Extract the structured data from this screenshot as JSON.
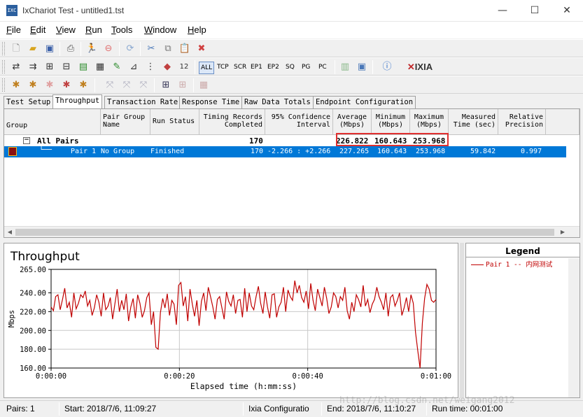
{
  "window": {
    "title": "IxChariot Test - untitled1.tst",
    "app_icon_text": "IXC",
    "minimize": "—",
    "maximize": "☐",
    "close": "✕"
  },
  "menu": [
    {
      "label": "File",
      "mnemonic": "F",
      "rest": "ile"
    },
    {
      "label": "Edit",
      "mnemonic": "E",
      "rest": "dit"
    },
    {
      "label": "View",
      "mnemonic": "V",
      "rest": "iew"
    },
    {
      "label": "Run",
      "mnemonic": "R",
      "rest": "un"
    },
    {
      "label": "Tools",
      "mnemonic": "T",
      "rest": "ools"
    },
    {
      "label": "Window",
      "mnemonic": "W",
      "rest": "indow"
    },
    {
      "label": "Help",
      "mnemonic": "H",
      "rest": "elp"
    }
  ],
  "toolbar2": {
    "all": "ALL",
    "tcp": "TCP",
    "scr": "SCR",
    "ep1": "EP1",
    "ep2": "EP2",
    "sq": "SQ",
    "pg": "PG",
    "pc": "PC",
    "brand": "IXIA"
  },
  "tabs": [
    "Test Setup",
    "Throughput",
    "Transaction Rate",
    "Response Time",
    "Raw Data Totals",
    "Endpoint Configuration"
  ],
  "active_tab": "Throughput",
  "grid": {
    "headers": {
      "group": "Group",
      "pair_group_name": "Pair Group\nName",
      "run_status": "Run Status",
      "timing_records": "Timing Records\nCompleted",
      "confidence": "95% Confidence\nInterval",
      "average": "Average\n(Mbps)",
      "minimum": "Minimum\n(Mbps)",
      "maximum": "Maximum\n(Mbps)",
      "measured_time": "Measured\nTime (sec)",
      "relative_precision": "Relative\nPrecision"
    },
    "all_pairs": {
      "toggle": "−",
      "group": "All Pairs",
      "timing_records": "170",
      "average": "226.822",
      "minimum": "160.643",
      "maximum": "253.968"
    },
    "pair1": {
      "name": "Pair 1",
      "pair_group_name": "No Group",
      "run_status": "Finished",
      "timing_records": "170",
      "confidence": "-2.266 : +2.266",
      "average": "227.265",
      "minimum": "160.643",
      "maximum": "253.968",
      "measured_time": "59.842",
      "relative_precision": "0.997"
    }
  },
  "chart_data": {
    "type": "line",
    "title": "Throughput",
    "xlabel": "Elapsed time (h:mm:ss)",
    "ylabel": "Mbps",
    "ylim": [
      160,
      265
    ],
    "xlim": [
      "0:00:00",
      "0:01:00"
    ],
    "yticks": [
      "265.00",
      "240.00",
      "220.00",
      "200.00",
      "180.00",
      "160.00"
    ],
    "xticks": [
      "0:00:00",
      "0:00:20",
      "0:00:40",
      "0:01:00"
    ],
    "grid": true,
    "color": "#c00000",
    "series": [
      {
        "name": "Pair 1 -- 内网测试",
        "values": [
          225,
          221,
          236,
          238,
          222,
          233,
          245,
          224,
          230,
          214,
          240,
          223,
          229,
          238,
          235,
          242,
          226,
          232,
          216,
          224,
          238,
          230,
          215,
          240,
          222,
          226,
          235,
          212,
          228,
          244,
          220,
          232,
          222,
          239,
          210,
          225,
          234,
          213,
          238,
          229,
          214,
          221,
          235,
          240,
          206,
          220,
          182,
          180,
          219,
          234,
          224,
          239,
          216,
          232,
          228,
          206,
          248,
          251,
          226,
          236,
          210,
          244,
          228,
          215,
          232,
          205,
          231,
          240,
          221,
          246,
          236,
          225,
          212,
          233,
          236,
          224,
          212,
          241,
          231,
          226,
          238,
          218,
          232,
          233,
          214,
          245,
          220,
          240,
          226,
          222,
          236,
          247,
          229,
          218,
          241,
          225,
          213,
          238,
          239,
          214,
          225,
          230,
          246,
          220,
          243,
          236,
          232,
          253,
          240,
          248,
          235,
          230,
          242,
          223,
          250,
          232,
          221,
          244,
          235,
          226,
          246,
          234,
          218,
          225,
          240,
          236,
          224,
          236,
          232,
          246,
          221,
          212,
          230,
          220,
          238,
          233,
          225,
          248,
          226,
          233,
          219,
          228,
          233,
          246,
          236,
          230,
          222,
          240,
          215,
          235,
          238,
          226,
          232,
          240,
          216,
          224,
          235,
          220,
          238,
          229,
          198,
          178,
          160,
          208,
          234,
          249,
          244,
          232,
          230,
          233
        ]
      }
    ]
  },
  "legend": {
    "title": "Legend",
    "entry": "Pair 1 -- 内网测试"
  },
  "status": {
    "pairs": "Pairs: 1",
    "start": "Start: 2018/7/6, 11:09:27",
    "ixia": "Ixia Configuratio",
    "end": "End: 2018/7/6, 11:10:27",
    "run_time": "Run time: 00:01:00"
  },
  "watermark": "http://blog.csdn.net/weigang2012"
}
